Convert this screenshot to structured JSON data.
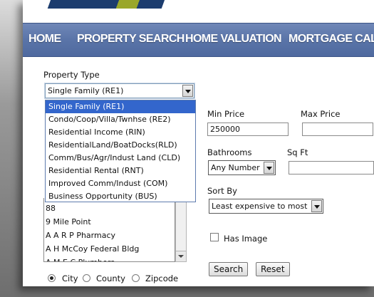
{
  "nav": {
    "items": [
      "HOME",
      "PROPERTY SEARCH",
      "HOME VALUATION",
      "MORTGAGE CALC"
    ]
  },
  "form": {
    "property_type_label": "Property Type",
    "property_type_selected": "Single Family (RE1)",
    "property_type_options": [
      "Single Family (RE1)",
      "Condo/Coop/Villa/Twnhse (RE2)",
      "Residential Income (RIN)",
      "ResidentialLand/BoatDocks(RLD)",
      "Comm/Bus/Agr/Indust Land (CLD)",
      "Residential Rental (RNT)",
      "Improved Comm/Indust (COM)",
      "Business Opportunity (BUS)"
    ],
    "min_price_label": "Min Price",
    "min_price_value": "250000",
    "max_price_label": "Max Price",
    "max_price_value": "",
    "bathrooms_label": "Bathrooms",
    "bathrooms_selected": "Any Number",
    "sqft_label": "Sq Ft",
    "sqft_value": "",
    "sort_by_label": "Sort By",
    "sort_by_selected": "Least expensive to most",
    "has_image_label": "Has Image",
    "location_list": [
      "88",
      "9 Mile Point",
      "A A R P Pharmacy",
      "A H McCoy Federal Bldg",
      "A M E C Plumbers"
    ],
    "location_type_options": [
      "City",
      "County",
      "Zipcode"
    ],
    "location_type_selected": "City",
    "search_button": "Search",
    "reset_button": "Reset"
  }
}
